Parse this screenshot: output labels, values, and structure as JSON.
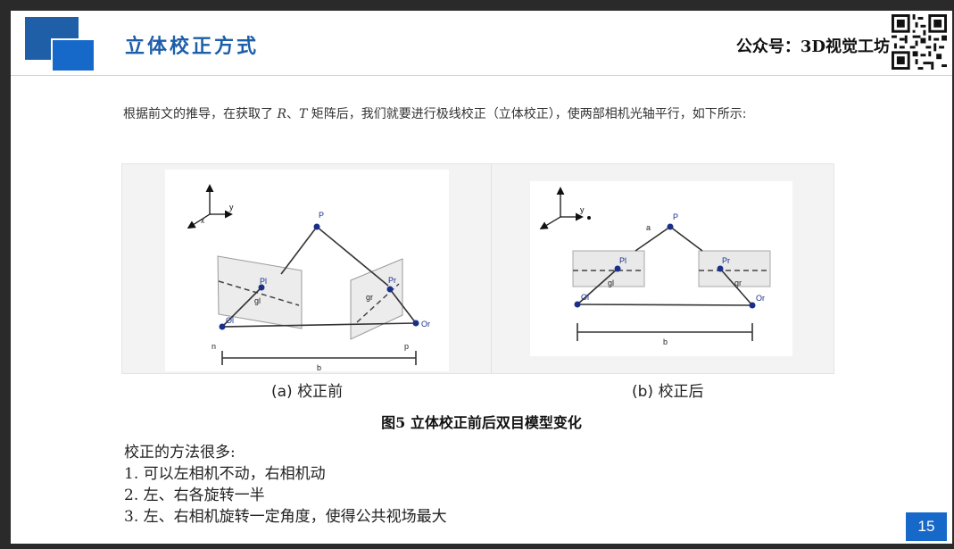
{
  "header": {
    "title": "立体校正方式",
    "brand": "公众号：3D视觉工坊"
  },
  "intro": {
    "prefix": "根据前文的推导，在获取了 ",
    "var_r": "R",
    "sep": "、",
    "var_t": "T",
    "suffix": " 矩阵后，我们就要进行极线校正（立体校正），使两部相机光轴平行，如下所示:"
  },
  "figure": {
    "panel_a": {
      "axis_y": "y",
      "axis_x": "x",
      "P": "P",
      "Pl": "Pl",
      "Pr": "Pr",
      "gl": "gl",
      "gr": "gr",
      "Ol": "Ol",
      "Or": "Or",
      "n": "n",
      "p": "p",
      "b": "b"
    },
    "panel_b": {
      "axis_y": "y",
      "a": "a",
      "P": "P",
      "Pl": "Pl",
      "Pr": "Pr",
      "gl": "gl",
      "gr": "gr",
      "Ol": "Ol",
      "Or": "Or",
      "b": "b"
    },
    "caption_a": "(a) 校正前",
    "caption_b": "(b) 校正后",
    "title": "图5 立体校正前后双目模型变化"
  },
  "methods": {
    "heading": "校正的方法很多:",
    "items": [
      "1.  可以左相机不动，右相机动",
      "2.  左、右各旋转一半",
      "3.  左、右相机旋转一定角度，使得公共视场最大"
    ]
  },
  "page_number": "15",
  "colors": {
    "brand_blue": "#1769c9",
    "title_blue": "#1d5ea8",
    "point_blue": "#1a2f8a"
  }
}
